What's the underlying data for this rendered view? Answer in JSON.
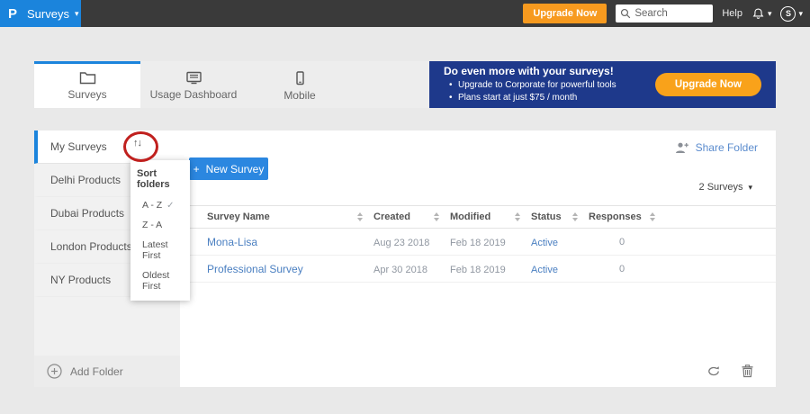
{
  "topbar": {
    "logo": "P",
    "app_menu": "Surveys",
    "upgrade_label": "Upgrade Now",
    "search_placeholder": "Search",
    "help_label": "Help",
    "avatar_initial": "S"
  },
  "tabs": [
    {
      "label": "Surveys",
      "icon": "folder-icon",
      "active": true
    },
    {
      "label": "Usage Dashboard",
      "icon": "dashboard-icon",
      "active": false
    },
    {
      "label": "Mobile",
      "icon": "mobile-icon",
      "active": false
    }
  ],
  "banner": {
    "title": "Do even more with your surveys!",
    "bullets": [
      "Upgrade to Corporate for powerful tools",
      "Plans start at just $75 / month"
    ],
    "cta": "Upgrade Now"
  },
  "sidebar": {
    "items": [
      {
        "label": "My Surveys",
        "active": true
      },
      {
        "label": "Delhi Products",
        "active": false
      },
      {
        "label": "Dubai Products",
        "active": false
      },
      {
        "label": "London Products",
        "active": false
      },
      {
        "label": "NY Products",
        "active": false
      }
    ],
    "add_folder_label": "Add Folder"
  },
  "sort_menu": {
    "title": "Sort folders",
    "options": [
      {
        "label": "A - Z",
        "checked": true
      },
      {
        "label": "Z - A",
        "checked": false
      },
      {
        "label": "Latest First",
        "checked": false
      },
      {
        "label": "Oldest First",
        "checked": false
      }
    ]
  },
  "toolbar": {
    "new_survey_label": "New Survey",
    "share_folder_label": "Share Folder",
    "survey_count": "2 Surveys"
  },
  "table": {
    "headers": [
      "Survey Name",
      "Created",
      "Modified",
      "Status",
      "Responses"
    ],
    "rows": [
      {
        "name": "Mona-Lisa",
        "created": "Aug 23 2018",
        "modified": "Feb 18 2019",
        "status": "Active",
        "responses": "0"
      },
      {
        "name": "Professional Survey",
        "created": "Apr 30 2018",
        "modified": "Feb 18 2019",
        "status": "Active",
        "responses": "0"
      }
    ]
  },
  "icons": {
    "caret": "▾",
    "check": "✓",
    "sort": "↑↓",
    "plus": "+"
  },
  "colors": {
    "brand_blue": "#1b84dc",
    "accent_blue": "#2b87e0",
    "orange": "#f79a1f",
    "banner_navy": "#1e398b",
    "link_blue": "#4a7fc1",
    "annotation_red": "#c0201e"
  }
}
